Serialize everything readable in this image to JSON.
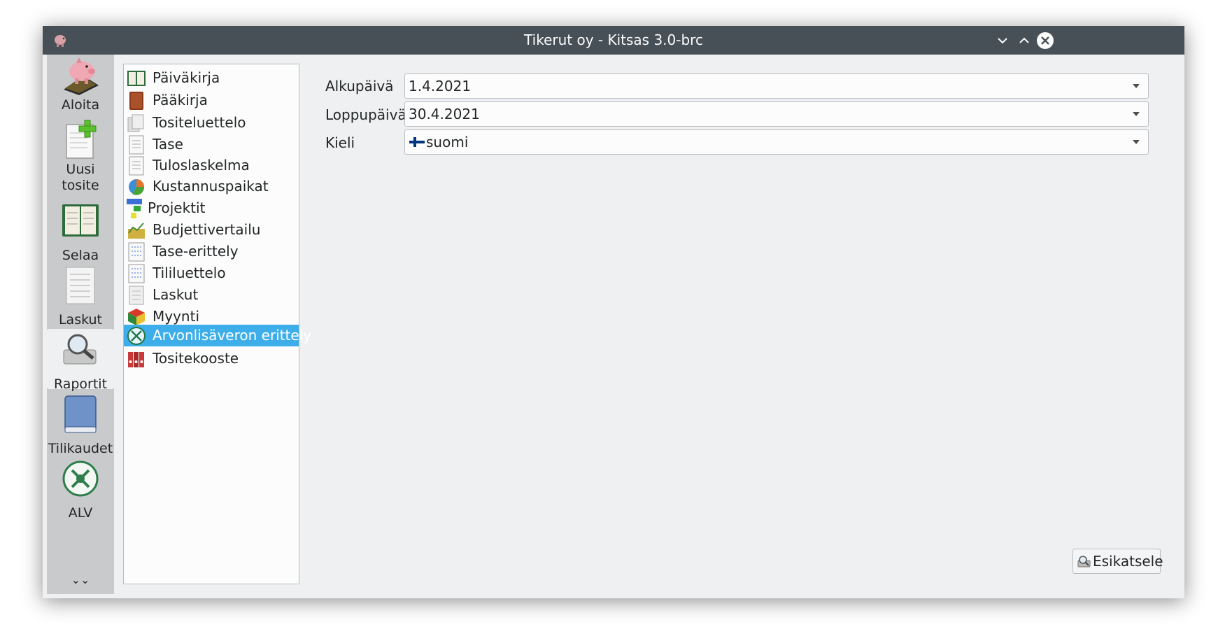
{
  "window": {
    "title": "Tikerut oy - Kitsas 3.0-brc"
  },
  "toolbar": {
    "items": [
      {
        "label": "Aloita",
        "icon": "piggy-bank-icon"
      },
      {
        "label": "Uusi tosite",
        "icon": "new-document-icon"
      },
      {
        "label": "Selaa",
        "icon": "ledger-book-icon"
      },
      {
        "label": "Laskut",
        "icon": "invoice-icon"
      },
      {
        "label": "Raportit",
        "icon": "report-magnifier-icon",
        "active": true
      },
      {
        "label": "Tilikaudet",
        "icon": "blue-book-icon"
      },
      {
        "label": "ALV",
        "icon": "vat-emblem-icon"
      }
    ],
    "more": "⌄⌄"
  },
  "reports": [
    {
      "label": "Päiväkirja",
      "icon": "journal-icon"
    },
    {
      "label": "Pääkirja",
      "icon": "general-ledger-icon"
    },
    {
      "label": "Tositeluettelo",
      "icon": "voucher-list-icon"
    },
    {
      "label": "Tase",
      "icon": "balance-sheet-icon"
    },
    {
      "label": "Tuloslaskelma",
      "icon": "income-statement-icon"
    },
    {
      "label": "Kustannuspaikat",
      "icon": "pie-chart-icon"
    },
    {
      "label": "Projektit",
      "icon": "projects-icon"
    },
    {
      "label": "Budjettivertailu",
      "icon": "budget-icon"
    },
    {
      "label": "Tase-erittely",
      "icon": "balance-detail-icon"
    },
    {
      "label": "Tililuettelo",
      "icon": "account-list-icon"
    },
    {
      "label": "Laskut",
      "icon": "invoices-icon"
    },
    {
      "label": "Myynti",
      "icon": "sales-box-icon"
    },
    {
      "label": "Arvonlisäveron erittely",
      "icon": "vat-detail-icon",
      "selected": true
    },
    {
      "label": "Tositekooste",
      "icon": "binders-icon"
    }
  ],
  "form": {
    "start_label": "Alkupäivä",
    "start_value": "1.4.2021",
    "end_label": "Loppupäivä",
    "end_value": "30.4.2021",
    "lang_label": "Kieli",
    "lang_value": "suomi"
  },
  "preview_button": "Esikatsele",
  "colors": {
    "titlebar": "#475057",
    "selection": "#3daee9",
    "toolbar_bg": "#c8cacc",
    "window_bg": "#eff0f1"
  }
}
